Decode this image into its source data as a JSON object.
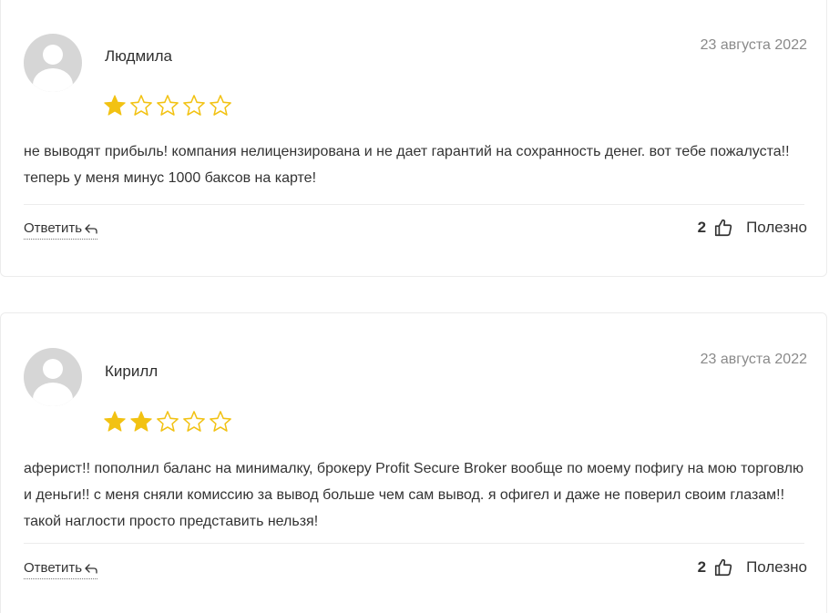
{
  "colors": {
    "star_filled": "#f2c213",
    "star_empty": "#f2c213",
    "text": "#333333",
    "date": "#8a8a8a",
    "border": "#ececec"
  },
  "reviews": [
    {
      "author": "Людмила",
      "date": "23 августа 2022",
      "rating": 1,
      "rating_max": 5,
      "text": "не выводят прибыль! компания нелицензирована и не дает гарантий на сохранность денег. вот тебе пожалуста!! теперь у меня минус 1000 баксов на карте!",
      "reply_label": "Ответить",
      "helpful_count": "2",
      "helpful_label": "Полезно"
    },
    {
      "author": "Кирилл",
      "date": "23 августа 2022",
      "rating": 2,
      "rating_max": 5,
      "text": "аферист!! пополнил баланс на минималку, брокеру Profit Secure Broker вообще по моему пофигу на мою торговлю и деньги!! с меня сняли комиссию за вывод больше чем сам вывод. я офигел и даже не поверил своим глазам!! такой наглости просто представить нельзя!",
      "reply_label": "Ответить",
      "helpful_count": "2",
      "helpful_label": "Полезно"
    }
  ]
}
